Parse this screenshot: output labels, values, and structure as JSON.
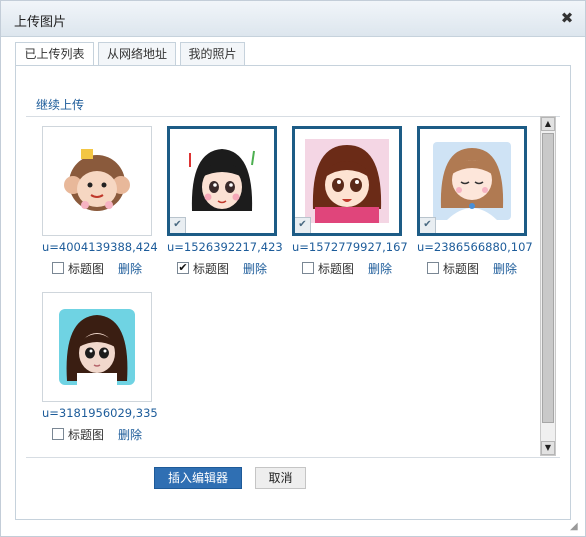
{
  "dialog": {
    "title": "上传图片",
    "close_symbol": "✖"
  },
  "tabs": [
    {
      "label": "已上传列表",
      "active": true
    },
    {
      "label": "从网络地址",
      "active": false
    },
    {
      "label": "我的照片",
      "active": false
    }
  ],
  "upload": {
    "continue_label": "继续上传"
  },
  "images": [
    {
      "name": "u=4004139388,424",
      "selected": false,
      "title_checked": false,
      "title_label": "标题图",
      "delete_label": "删除",
      "icon": "cartoon-monkey-icon"
    },
    {
      "name": "u=1526392217,423",
      "selected": true,
      "title_checked": true,
      "title_label": "标题图",
      "delete_label": "删除",
      "icon": "cartoon-girl-black-hair-icon"
    },
    {
      "name": "u=1572779927,167",
      "selected": true,
      "title_checked": false,
      "title_label": "标题图",
      "delete_label": "删除",
      "icon": "cartoon-girl-brown-hair-icon"
    },
    {
      "name": "u=2386566880,107",
      "selected": true,
      "title_checked": false,
      "title_label": "标题图",
      "delete_label": "删除",
      "icon": "cartoon-girl-blue-dress-icon"
    },
    {
      "name": "u=3181956029,335",
      "selected": false,
      "title_checked": false,
      "title_label": "标题图",
      "delete_label": "删除",
      "icon": "doll-photo-icon"
    }
  ],
  "buttons": {
    "insert_label": "插入编辑器",
    "cancel_label": "取消"
  },
  "colors": {
    "accent": "#2f6fb3",
    "selection_border": "#1d5c86",
    "link": "#1d5c9a"
  }
}
